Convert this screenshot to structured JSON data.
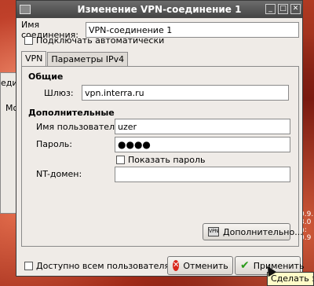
{
  "window": {
    "title": "Изменение VPN-соединение 1"
  },
  "connection_name": {
    "label": "Имя соединения:",
    "value": "VPN-соединение 1"
  },
  "autoconnect": {
    "label": "Подключать автоматически"
  },
  "tabs": [
    {
      "label": "VPN"
    },
    {
      "label": "Параметры IPv4"
    }
  ],
  "general": {
    "heading": "Общие",
    "gateway_label": "Шлюз:",
    "gateway_value": "vpn.interra.ru"
  },
  "optional": {
    "heading": "Дополнительные",
    "username_label": "Имя пользователя:",
    "username_value": "uzer",
    "password_label": "Пароль:",
    "password_value": "●●●●",
    "show_password_label": "Показать пароль",
    "nt_domain_label": "NT-домен:",
    "nt_domain_value": ""
  },
  "advanced_button": {
    "label": "Дополнительно..."
  },
  "footer": {
    "available_all_label": "Доступно всем пользователям",
    "cancel_label": "Отменить",
    "apply_label": "Применить"
  },
  "tooltip": {
    "text": "Сделать эт"
  },
  "background": {
    "app_text_1": "еди",
    "app_text_2": "Мо",
    "right_text": "0.9.\n3.0\nn:\n0.9"
  },
  "colors": {
    "titlebar": "#555555",
    "window_bg": "#efebe7",
    "cancel_red": "#d8261a",
    "apply_green": "#2a9a1a"
  }
}
